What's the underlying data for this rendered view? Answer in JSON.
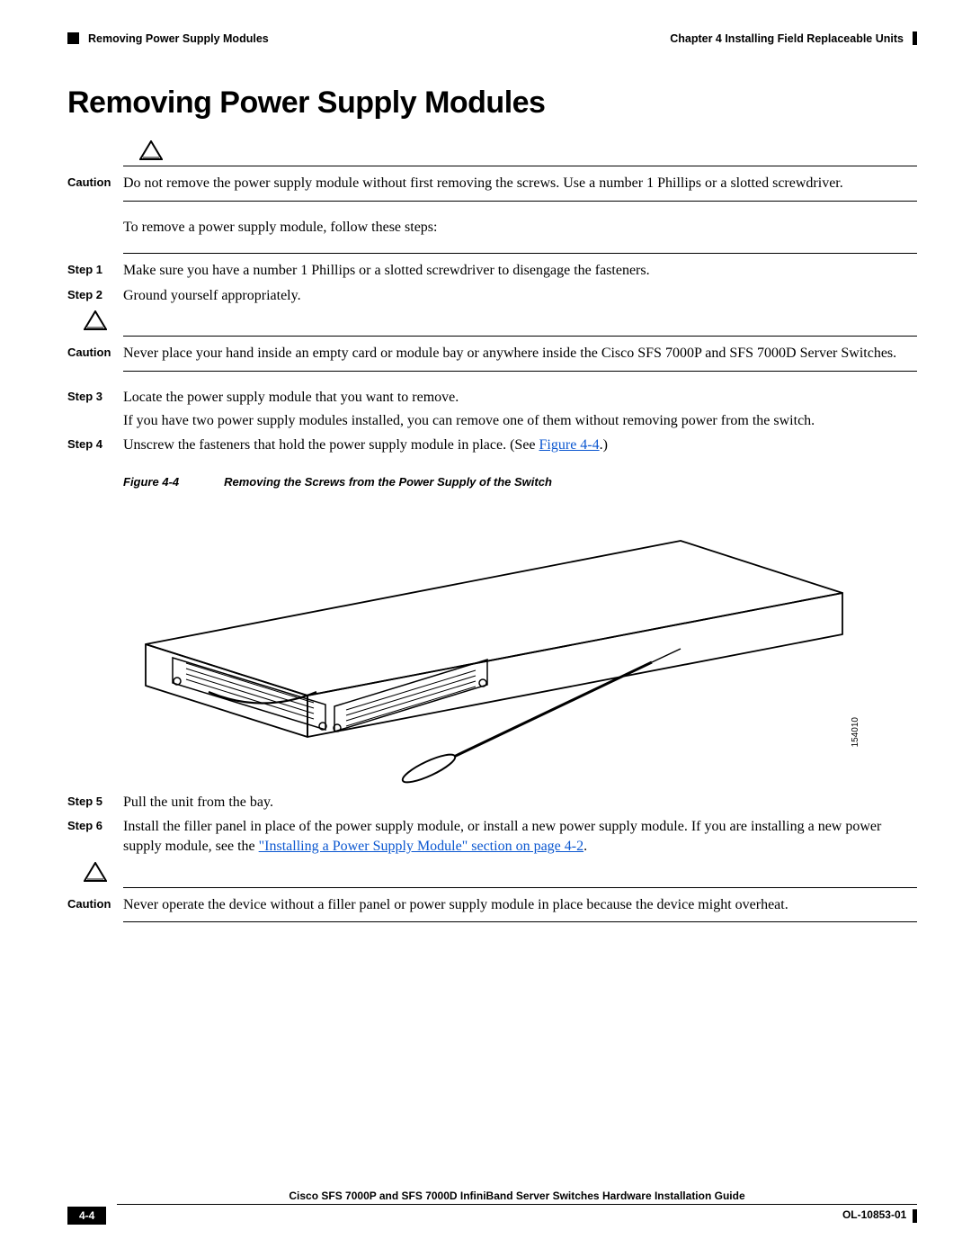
{
  "header": {
    "left_section": "Removing Power Supply Modules",
    "right_chapter": "Chapter 4      Installing Field Replaceable Units"
  },
  "title": "Removing Power Supply Modules",
  "caution1": {
    "label": "Caution",
    "text": "Do not remove the power supply module without first removing the screws. Use a number 1 Phillips or a slotted screwdriver."
  },
  "intro": "To remove a power supply module, follow these steps:",
  "steps_a": [
    {
      "label": "Step 1",
      "text": "Make sure you have a number 1 Phillips or a slotted screwdriver to disengage the fasteners."
    },
    {
      "label": "Step 2",
      "text": "Ground yourself appropriately."
    }
  ],
  "caution2": {
    "label": "Caution",
    "text": "Never place your hand inside an empty card or module bay or anywhere inside the Cisco SFS 7000P and SFS 7000D Server Switches."
  },
  "steps_b": [
    {
      "label": "Step 3",
      "text": "Locate the power supply module that you want to remove.",
      "extra": "If you have two power supply modules installed, you can remove one of them without removing power from the switch."
    },
    {
      "label": "Step 4",
      "text_pre": "Unscrew the fasteners that hold the power supply module in place. (See ",
      "link": "Figure 4-4",
      "text_post": ".)"
    }
  ],
  "figure": {
    "num": "Figure 4-4",
    "caption": "Removing the Screws from the Power Supply of the Switch",
    "id": "154010"
  },
  "steps_c": [
    {
      "label": "Step 5",
      "text": "Pull the unit from the bay."
    },
    {
      "label": "Step 6",
      "text_pre": "Install the filler panel in place of the power supply module, or install a new power supply module. If you are installing a new power supply module, see the ",
      "link": "\"Installing a Power Supply Module\" section on page 4-2",
      "text_post": "."
    }
  ],
  "caution3": {
    "label": "Caution",
    "text": "Never operate the device without a filler panel or power supply module in place because the device might overheat."
  },
  "footer": {
    "guide": "Cisco SFS 7000P and SFS 7000D InfiniBand Server Switches Hardware Installation Guide",
    "page": "4-4",
    "doc": "OL-10853-01"
  }
}
